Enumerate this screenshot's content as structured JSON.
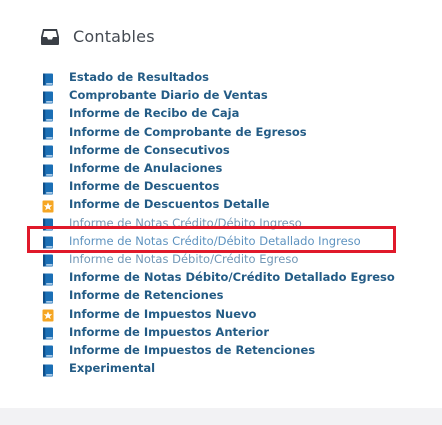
{
  "section": {
    "title": "Contables",
    "icon": "inbox-tray-icon"
  },
  "colors": {
    "link": "#245c86",
    "book_icon": "#1b6fb5",
    "star_icon": "#f5a623",
    "highlight_border": "#e0192a"
  },
  "reports": [
    {
      "label": "Estado de Resultados",
      "icon": "book-icon"
    },
    {
      "label": "Comprobante Diario de Ventas",
      "icon": "book-icon"
    },
    {
      "label": "Informe de Recibo de Caja",
      "icon": "book-icon"
    },
    {
      "label": "Informe de Comprobante de Egresos",
      "icon": "book-icon"
    },
    {
      "label": "Informe de Consecutivos",
      "icon": "book-icon"
    },
    {
      "label": "Informe de Anulaciones",
      "icon": "book-icon"
    },
    {
      "label": "Informe de Descuentos",
      "icon": "book-icon"
    },
    {
      "label": "Informe de Descuentos Detalle",
      "icon": "star-icon"
    },
    {
      "label": "Informe de Notas Crédito/Débito Ingreso",
      "icon": "book-icon"
    },
    {
      "label": "Informe de Notas Crédito/Débito Detallado Ingreso",
      "icon": "book-icon"
    },
    {
      "label": "Informe de Notas Débito/Crédito Egreso",
      "icon": "book-icon"
    },
    {
      "label": "Informe de Notas Débito/Crédito Detallado Egreso",
      "icon": "book-icon"
    },
    {
      "label": "Informe de Retenciones",
      "icon": "book-icon"
    },
    {
      "label": "Informe de Impuestos Nuevo",
      "icon": "star-icon"
    },
    {
      "label": "Informe de Impuestos Anterior",
      "icon": "book-icon"
    },
    {
      "label": "Informe de Impuestos de Retenciones",
      "icon": "book-icon"
    },
    {
      "label": "Experimental",
      "icon": "book-icon"
    }
  ]
}
